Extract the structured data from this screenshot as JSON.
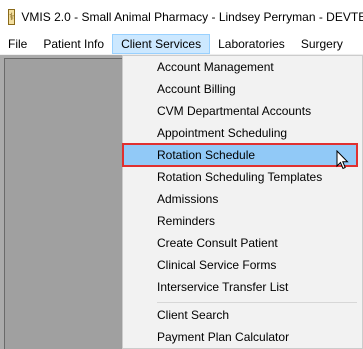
{
  "window": {
    "title": "VMIS 2.0 - Small Animal Pharmacy - Lindsey Perryman - DEVTE",
    "icon": "app-icon"
  },
  "menubar": {
    "items": [
      {
        "label": "File"
      },
      {
        "label": "Patient Info"
      },
      {
        "label": "Client Services"
      },
      {
        "label": "Laboratories"
      },
      {
        "label": "Surgery"
      }
    ],
    "open_menu": "Client Services"
  },
  "dropdown": {
    "items": [
      {
        "label": "Account Management"
      },
      {
        "label": "Account Billing"
      },
      {
        "label": "CVM Departmental Accounts"
      },
      {
        "label": "Appointment Scheduling"
      },
      {
        "label": "Rotation Schedule"
      },
      {
        "label": "Rotation Scheduling Templates"
      },
      {
        "label": "Admissions"
      },
      {
        "label": "Reminders"
      },
      {
        "label": "Create Consult Patient"
      },
      {
        "label": "Clinical Service Forms"
      },
      {
        "label": "Interservice Transfer List"
      },
      {
        "label": "Client Search"
      },
      {
        "label": "Payment Plan Calculator"
      }
    ],
    "highlighted": "Rotation Schedule"
  },
  "colors": {
    "highlight_fill": "#91c9f7",
    "highlight_border": "#e03030",
    "open_menu_fill": "#cce8ff"
  }
}
